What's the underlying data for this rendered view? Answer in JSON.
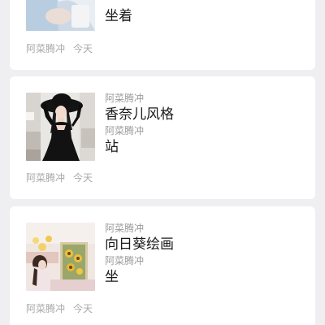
{
  "articles": [
    {
      "source": "",
      "title_1": "",
      "source_2": "",
      "title_2": "坐着",
      "footer_source": "阿菜腾冲",
      "footer_time": "今天",
      "image": "partial-photo-blue-white-outfit"
    },
    {
      "source": "阿菜腾冲",
      "title_1": "香奈儿风格",
      "source_2": "阿菜腾冲",
      "title_2": "站",
      "footer_source": "阿菜腾冲",
      "footer_time": "今天",
      "image": "photo-woman-black-dress-black-hat"
    },
    {
      "source": "阿菜腾冲",
      "title_1": "向日葵绘画",
      "source_2": "阿菜腾冲",
      "title_2": "坐",
      "footer_source": "阿菜腾冲",
      "footer_time": "今天",
      "image": "photo-girl-painting-sunflowers"
    }
  ],
  "colors": {
    "background": "#efeff2",
    "card": "#ffffff",
    "title": "#1a1a1a",
    "meta": "#9b9b9b"
  }
}
